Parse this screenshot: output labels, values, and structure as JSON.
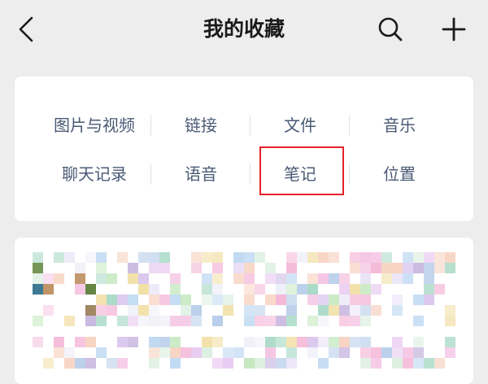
{
  "header": {
    "title": "我的收藏",
    "back_icon": "chevron-left-icon",
    "search_icon": "search-icon",
    "add_icon": "plus-icon",
    "background": "#EDEDED"
  },
  "categories": {
    "row1": [
      "图片与视频",
      "链接",
      "文件",
      "音乐"
    ],
    "row2": [
      "聊天记录",
      "语音",
      "笔记",
      "位置"
    ],
    "highlighted": "笔记",
    "highlight_color": "#E5222A",
    "text_color": "#4A5A75"
  },
  "content_preview": {
    "state": "pixelated/blurred"
  }
}
